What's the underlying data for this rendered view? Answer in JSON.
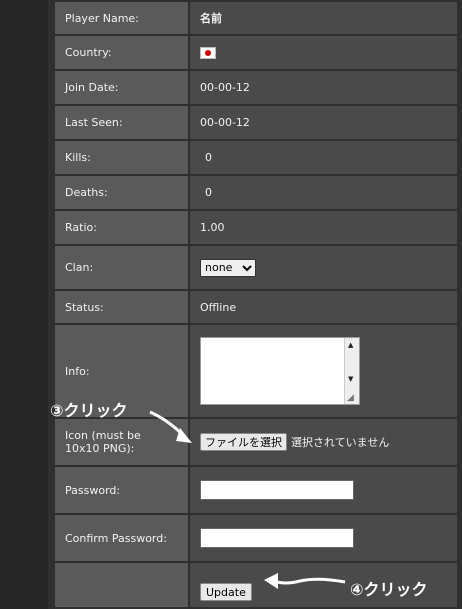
{
  "profile": {
    "player_name": {
      "label": "Player Name:",
      "value": "名前"
    },
    "country": {
      "label": "Country:",
      "flag": "japan-flag"
    },
    "join_date": {
      "label": "Join Date:",
      "value": "00-00-12"
    },
    "last_seen": {
      "label": "Last Seen:",
      "value": "00-00-12"
    },
    "kills": {
      "label": "Kills:",
      "value": "0"
    },
    "deaths": {
      "label": "Deaths:",
      "value": "0"
    },
    "ratio": {
      "label": "Ratio:",
      "value": "1.00"
    },
    "clan": {
      "label": "Clan:",
      "selected": "none"
    },
    "status": {
      "label": "Status:",
      "value": "Offline"
    },
    "info": {
      "label": "Info:",
      "value": ""
    },
    "icon": {
      "label_line1": "Icon (must be",
      "label_line2": "10x10 PNG):",
      "button": "ファイルを選択",
      "no_file": "選択されていません"
    },
    "password": {
      "label": "Password:",
      "value": ""
    },
    "confirm_password": {
      "label": "Confirm Password:",
      "value": ""
    },
    "update_button": "Update"
  },
  "annotations": {
    "step3": "③クリック",
    "step4": "④クリック"
  },
  "colors": {
    "label_cell": "#5a5a5a",
    "value_cell": "#4a4a4a",
    "background": "#2f2f2f"
  }
}
